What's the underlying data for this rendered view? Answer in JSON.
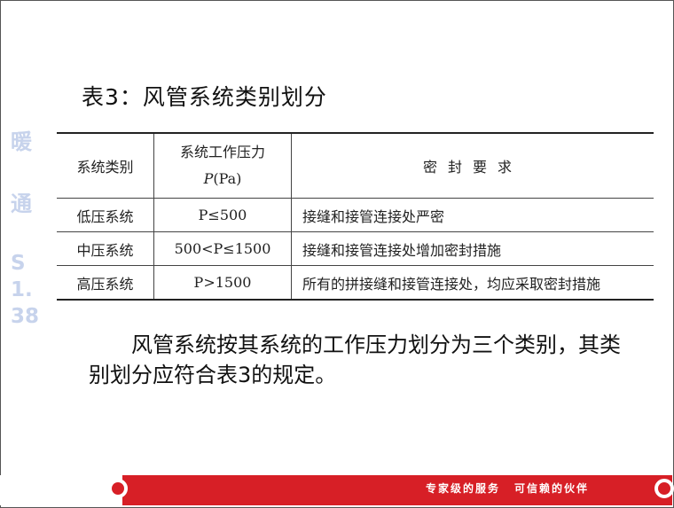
{
  "side_labels": [
    "暖",
    "通",
    "S1.38"
  ],
  "title": "表3：风管系统类别划分",
  "table": {
    "headers": {
      "category": "系统类别",
      "pressure_line1": "系统工作压力",
      "pressure_symbol": "P",
      "pressure_unit": "(Pa)",
      "seal": "密封要求"
    },
    "rows": [
      {
        "category": "低压系统",
        "pressure": "P≤500",
        "seal": "接缝和接管连接处严密"
      },
      {
        "category": "中压系统",
        "pressure": "500<P≤1500",
        "seal": "接缝和接管连接处增加密封措施"
      },
      {
        "category": "高压系统",
        "pressure": "P>1500",
        "seal": "所有的拼接缝和接管连接处，均应采取密封措施"
      }
    ]
  },
  "paragraph": "风管系统按其系统的工作压力划分为三个类别，其类别划分应符合表3的规定。",
  "footer": {
    "slogan_1": "专家级的服务",
    "slogan_2": "可信赖的伙伴",
    "bar_color": "#d71f26"
  }
}
